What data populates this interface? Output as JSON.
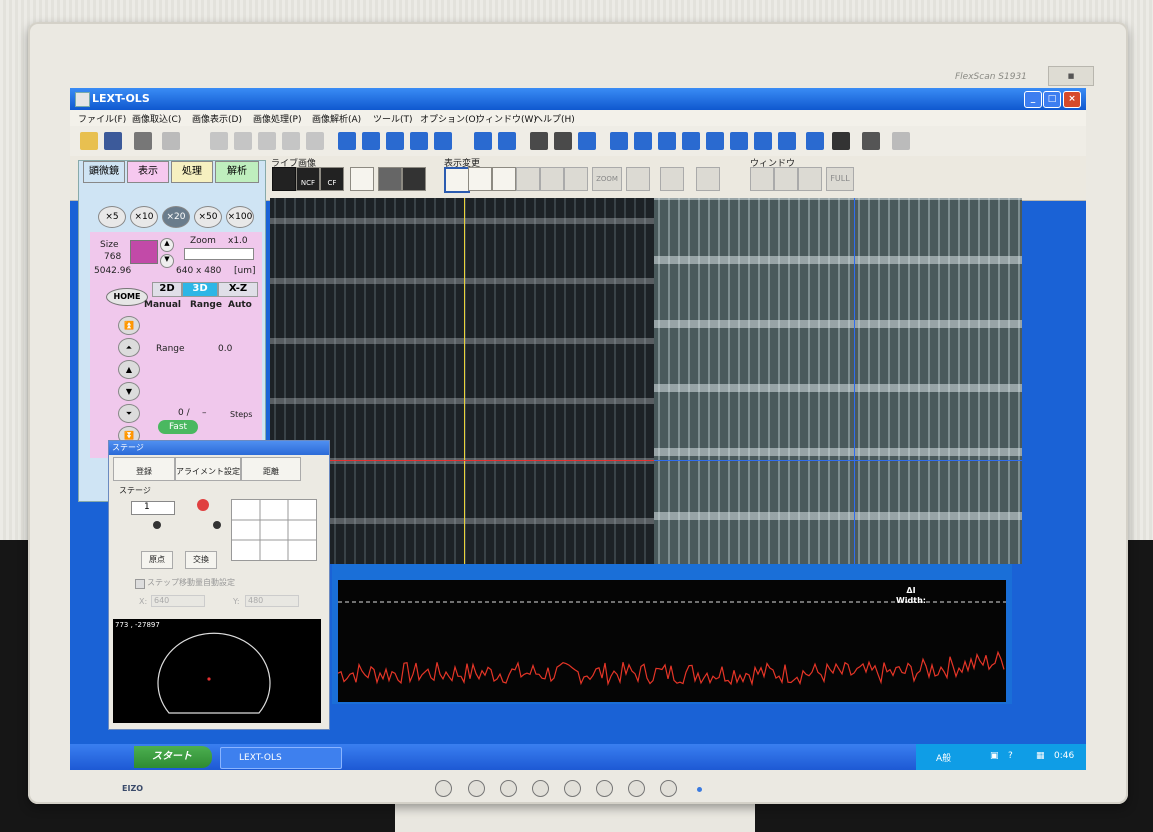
{
  "window": {
    "title": "LEXT-OLS"
  },
  "menubar": [
    "ファイル(F)",
    "画像取込(C)",
    "画像表示(D)",
    "画像処理(P)",
    "画像解析(A)",
    "ツール(T)",
    "オプション(O)",
    "ウィンドウ(W)",
    "ヘルプ(H)"
  ],
  "ribbon": {
    "group_live": "ライブ画像",
    "group_display": "表示変更",
    "group_window": "ウィンドウ",
    "btn_ncf": "NCF",
    "btn_cf": "CF",
    "btn_zoom": "ZOOM",
    "btn_full": "FULL"
  },
  "left_panel": {
    "tabs": [
      "顕微鏡",
      "表示",
      "処理",
      "解析"
    ],
    "objectives": [
      "×5",
      "×10",
      "×20",
      "×50",
      "×100"
    ],
    "size_label": "Size",
    "size_value": "768",
    "size_um": "5042.96",
    "zoom_label": "Zoom",
    "zoom_value": "x1.0",
    "resolution": "640 x 480",
    "unit": "[um]",
    "home": "HOME",
    "modes": [
      "2D",
      "3D",
      "X-Z"
    ],
    "scan_modes": [
      "Manual",
      "Range",
      "Auto"
    ],
    "range_label": "Range",
    "range_value": "0.0",
    "steps_value": "0 /",
    "steps_sep": "–",
    "steps_label": "Steps",
    "fast": "Fast"
  },
  "stage_dialog": {
    "title": "ステージ",
    "btn_register": "登録",
    "btn_alignment": "アライメント設定",
    "btn_distance": "距離",
    "group_label": "ステージ",
    "spin_value": "1",
    "btn_origin": "原点",
    "btn_swap": "交換",
    "checkbox_label": "ステップ移動量自動設定",
    "x_label": "X:",
    "x_value": "640",
    "y_label": "Y:",
    "y_value": "480",
    "coords": "773 , -27897"
  },
  "profile": {
    "delta": "ΔI",
    "width": "Width:"
  },
  "taskbar": {
    "start": "スタート",
    "task": "LEXT-OLS",
    "ime": "A般",
    "clock": "0:46"
  },
  "monitor": {
    "model": "FlexScan S1931",
    "brand": "EIZO"
  },
  "colors": {
    "profile_trace": "#e53527",
    "crosshair_yellow": "#e9d23a",
    "crosshair_red": "#e53030",
    "crosshair_blue": "#2f6cf0",
    "panel_pink": "#f0c8ec"
  }
}
